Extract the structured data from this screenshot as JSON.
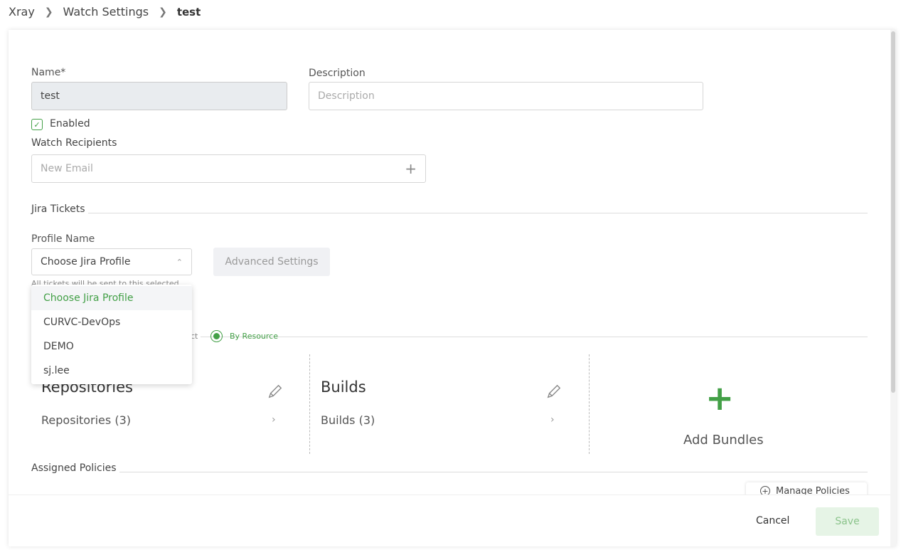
{
  "breadcrumb": {
    "items": [
      "Xray",
      "Watch Settings"
    ],
    "current": "test"
  },
  "form": {
    "name_label": "Name*",
    "name_value": "test",
    "description_label": "Description",
    "description_placeholder": "Description",
    "enabled_label": "Enabled",
    "enabled": true,
    "recipients_label": "Watch Recipients",
    "email_placeholder": "New Email"
  },
  "jira": {
    "section_title": "Jira Tickets",
    "profile_label": "Profile Name",
    "profile_selected": "Choose Jira Profile",
    "advanced_settings": "Advanced Settings",
    "hint": "All tickets will be sent to this selected",
    "options": [
      "Choose Jira Profile",
      "CURVC-DevOps",
      "DEMO",
      "sj.lee"
    ]
  },
  "resources": {
    "by_project_partial": "ct",
    "by_resource_label": "By Resource",
    "repositories_title": "Repositories",
    "repositories_link": "Repositories (3)",
    "builds_title": "Builds",
    "builds_link": "Builds (3)",
    "add_bundles": "Add Bundles"
  },
  "policies": {
    "section_title": "Assigned Policies",
    "manage_label": "Manage Policies"
  },
  "footer": {
    "cancel": "Cancel",
    "save": "Save"
  },
  "colors": {
    "accent": "#43a047"
  }
}
